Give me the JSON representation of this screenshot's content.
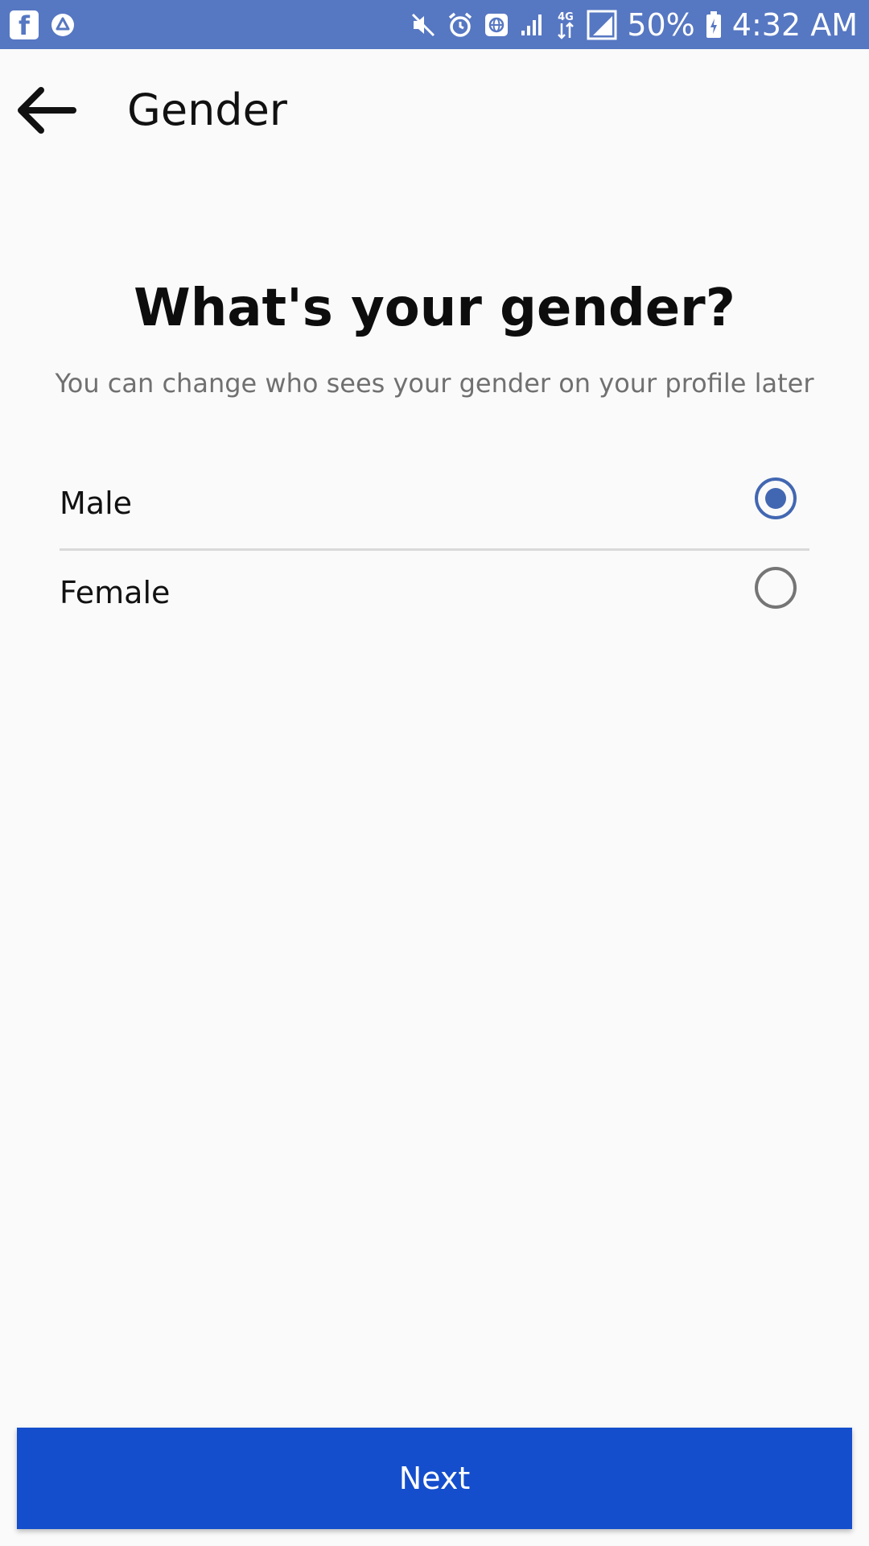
{
  "status_bar": {
    "battery": "50%",
    "time": "4:32 AM",
    "network": "4G",
    "icons": [
      "facebook-icon",
      "drive-icon",
      "mute-icon",
      "alarm-icon",
      "vpn-globe-icon",
      "wifi-signal-icon",
      "data-arrows-icon",
      "cell-signal-icon",
      "battery-icon"
    ]
  },
  "app_bar": {
    "title": "Gender",
    "back_icon": "arrow-left-icon"
  },
  "question": {
    "title": "What's your gender?",
    "subtitle": "You can change who sees your gender on your profile later"
  },
  "options": [
    {
      "label": "Male",
      "selected": true
    },
    {
      "label": "Female",
      "selected": false
    }
  ],
  "footer": {
    "next_label": "Next"
  },
  "colors": {
    "status_bar": "#5677c2",
    "accent": "#4267b2",
    "button": "#144ecc",
    "background": "#fafafa"
  }
}
